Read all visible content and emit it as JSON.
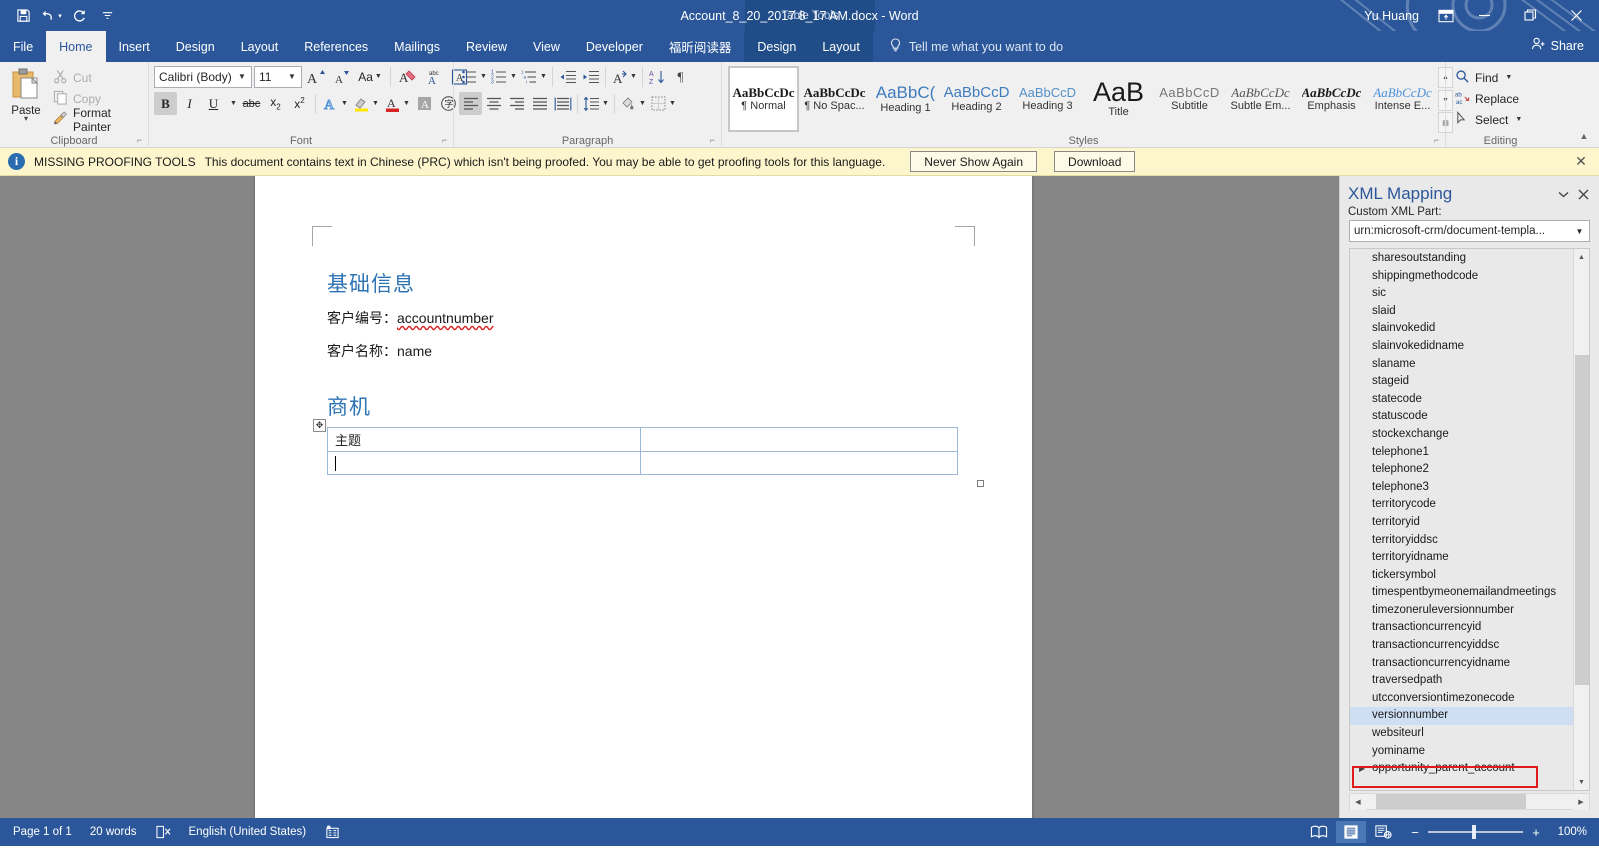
{
  "titlebar": {
    "quick_access": [
      {
        "name": "save-icon",
        "tooltip": "Save"
      },
      {
        "name": "undo-icon",
        "tooltip": "Undo"
      },
      {
        "name": "redo-icon",
        "tooltip": "Redo"
      },
      {
        "name": "customize-qat-icon",
        "tooltip": "Customize Quick Access Toolbar"
      }
    ],
    "document_title": "Account_8_20_2017 8_17 AM.docx  -  Word",
    "contextual_tools_label": "Table Tools",
    "user_name": "Yu Huang",
    "ribbon_display_options": "ribbon-display-icon",
    "minimize": "minimize-icon",
    "restore": "restore-icon",
    "close": "close-icon"
  },
  "tabs": [
    {
      "label": "File",
      "active": false,
      "contextual": false
    },
    {
      "label": "Home",
      "active": true,
      "contextual": false
    },
    {
      "label": "Insert",
      "active": false,
      "contextual": false
    },
    {
      "label": "Design",
      "active": false,
      "contextual": false
    },
    {
      "label": "Layout",
      "active": false,
      "contextual": false
    },
    {
      "label": "References",
      "active": false,
      "contextual": false
    },
    {
      "label": "Mailings",
      "active": false,
      "contextual": false
    },
    {
      "label": "Review",
      "active": false,
      "contextual": false
    },
    {
      "label": "View",
      "active": false,
      "contextual": false
    },
    {
      "label": "Developer",
      "active": false,
      "contextual": false
    },
    {
      "label": "福昕阅读器",
      "active": false,
      "contextual": false
    },
    {
      "label": "Design",
      "active": false,
      "contextual": true
    },
    {
      "label": "Layout",
      "active": false,
      "contextual": true
    }
  ],
  "tell_me": {
    "placeholder": "Tell me what you want to do",
    "icon": "lightbulb-icon"
  },
  "share": {
    "label": "Share",
    "icon": "share-person-icon"
  },
  "ribbon": {
    "groups": [
      {
        "name": "clipboard",
        "label": "Clipboard",
        "paste": {
          "label": "Paste",
          "icon": "paste-icon"
        },
        "items": [
          {
            "label": "Cut",
            "icon": "cut-scissors-icon",
            "disabled": true
          },
          {
            "label": "Copy",
            "icon": "copy-icon",
            "disabled": true
          },
          {
            "label": "Format Painter",
            "icon": "format-painter-icon",
            "disabled": false
          }
        ]
      },
      {
        "name": "font",
        "label": "Font",
        "font_name": "Calibri (Body)",
        "font_size": "11",
        "buttons_row1": [
          {
            "name": "grow-font-icon",
            "label": "A▴"
          },
          {
            "name": "shrink-font-icon",
            "label": "A▾"
          },
          {
            "name": "change-case-icon",
            "label": "Aa"
          },
          {
            "name": "clear-formatting-icon",
            "label": "A"
          },
          {
            "name": "phonetic-guide-icon",
            "label": "⎇"
          },
          {
            "name": "character-border-icon",
            "label": "A"
          }
        ],
        "buttons_row2": [
          {
            "name": "bold-icon",
            "label": "B",
            "active": true
          },
          {
            "name": "italic-icon",
            "label": "I",
            "active": false
          },
          {
            "name": "underline-icon",
            "label": "U",
            "active": false
          },
          {
            "name": "strikethrough-icon",
            "label": "abc",
            "active": false
          },
          {
            "name": "subscript-icon",
            "label": "x₂",
            "active": false
          },
          {
            "name": "superscript-icon",
            "label": "x²",
            "active": false
          },
          {
            "name": "text-effects-icon",
            "label": "A",
            "active": false
          },
          {
            "name": "text-highlight-color-icon",
            "label": "ab",
            "active": false
          },
          {
            "name": "font-color-icon",
            "label": "A",
            "active": false
          },
          {
            "name": "character-shading-icon",
            "label": "A",
            "active": false
          },
          {
            "name": "enclose-characters-icon",
            "label": "字",
            "active": false
          }
        ]
      },
      {
        "name": "paragraph",
        "label": "Paragraph",
        "buttons_row1": [
          {
            "name": "bullets-icon"
          },
          {
            "name": "numbering-icon"
          },
          {
            "name": "multilevel-list-icon"
          },
          {
            "name": "decrease-indent-icon"
          },
          {
            "name": "increase-indent-icon"
          },
          {
            "name": "asian-layout-icon"
          },
          {
            "name": "sort-icon"
          },
          {
            "name": "show-formatting-marks-icon"
          }
        ],
        "buttons_row2": [
          {
            "name": "align-left-icon",
            "active": true
          },
          {
            "name": "align-center-icon",
            "active": false
          },
          {
            "name": "align-right-icon",
            "active": false
          },
          {
            "name": "justify-icon",
            "active": false
          },
          {
            "name": "distributed-icon",
            "active": false
          },
          {
            "name": "line-spacing-icon",
            "active": false
          },
          {
            "name": "shading-icon",
            "active": false
          },
          {
            "name": "borders-icon",
            "active": false
          }
        ]
      },
      {
        "name": "styles",
        "label": "Styles",
        "gallery": [
          {
            "preview": "AaBbCcDc",
            "name": "¶ Normal",
            "selected": true,
            "css": "normal"
          },
          {
            "preview": "AaBbCcDc",
            "name": "¶ No Spac...",
            "selected": false,
            "css": "nospace"
          },
          {
            "preview": "AaBbC(",
            "name": "Heading 1",
            "selected": false,
            "css": "h1"
          },
          {
            "preview": "AaBbCcD",
            "name": "Heading 2",
            "selected": false,
            "css": "h2"
          },
          {
            "preview": "AaBbCcD",
            "name": "Heading 3",
            "selected": false,
            "css": "h3"
          },
          {
            "preview": "AaB",
            "name": "Title",
            "selected": false,
            "css": "title"
          },
          {
            "preview": "AaBbCcD",
            "name": "Subtitle",
            "selected": false,
            "css": "subtitle"
          },
          {
            "preview": "AaBbCcDc",
            "name": "Subtle Em...",
            "selected": false,
            "css": "subtleem"
          },
          {
            "preview": "AaBbCcDc",
            "name": "Emphasis",
            "selected": false,
            "css": "emphasis"
          },
          {
            "preview": "AaBbCcDc",
            "name": "Intense E...",
            "selected": false,
            "css": "intense"
          }
        ]
      },
      {
        "name": "editing",
        "label": "Editing",
        "items": [
          {
            "label": "Find",
            "icon": "find-magnifier-icon",
            "dropdown": true
          },
          {
            "label": "Replace",
            "icon": "replace-icon",
            "dropdown": false
          },
          {
            "label": "Select",
            "icon": "select-pointer-icon",
            "dropdown": true
          }
        ]
      }
    ],
    "collapse_icon": "collapse-ribbon-icon"
  },
  "message_bar": {
    "icon": "info-icon",
    "headline": "MISSING PROOFING TOOLS",
    "text": "This document contains text in Chinese (PRC) which isn't being proofed. You may be able to get proofing tools for this language.",
    "buttons": [
      {
        "label": "Never Show Again"
      },
      {
        "label": "Download"
      }
    ],
    "close": "close-icon"
  },
  "document": {
    "heading1": "基础信息",
    "line1_label": "客户编号：",
    "line1_value": "accountnumber",
    "line2_label": "客户名称：",
    "line2_value": "name",
    "heading2": "商机",
    "table": {
      "move_handle": "table-move-handle",
      "resize_handle": "table-resize-handle",
      "rows": [
        [
          "主题",
          ""
        ],
        [
          "",
          ""
        ]
      ]
    }
  },
  "xml_pane": {
    "title": "XML Mapping",
    "menu_icon": "chevron-down-icon",
    "close_icon": "close-icon",
    "custom_part_label": "Custom XML Part:",
    "custom_part_value": "urn:microsoft-crm/document-templa...",
    "nodes": [
      {
        "label": "sharesoutstanding",
        "selected": false,
        "expandable": false,
        "highlight": false
      },
      {
        "label": "shippingmethodcode",
        "selected": false,
        "expandable": false,
        "highlight": false
      },
      {
        "label": "sic",
        "selected": false,
        "expandable": false,
        "highlight": false
      },
      {
        "label": "slaid",
        "selected": false,
        "expandable": false,
        "highlight": false
      },
      {
        "label": "slainvokedid",
        "selected": false,
        "expandable": false,
        "highlight": false
      },
      {
        "label": "slainvokedidname",
        "selected": false,
        "expandable": false,
        "highlight": false
      },
      {
        "label": "slaname",
        "selected": false,
        "expandable": false,
        "highlight": false
      },
      {
        "label": "stageid",
        "selected": false,
        "expandable": false,
        "highlight": false
      },
      {
        "label": "statecode",
        "selected": false,
        "expandable": false,
        "highlight": false
      },
      {
        "label": "statuscode",
        "selected": false,
        "expandable": false,
        "highlight": false
      },
      {
        "label": "stockexchange",
        "selected": false,
        "expandable": false,
        "highlight": false
      },
      {
        "label": "telephone1",
        "selected": false,
        "expandable": false,
        "highlight": false
      },
      {
        "label": "telephone2",
        "selected": false,
        "expandable": false,
        "highlight": false
      },
      {
        "label": "telephone3",
        "selected": false,
        "expandable": false,
        "highlight": false
      },
      {
        "label": "territorycode",
        "selected": false,
        "expandable": false,
        "highlight": false
      },
      {
        "label": "territoryid",
        "selected": false,
        "expandable": false,
        "highlight": false
      },
      {
        "label": "territoryiddsc",
        "selected": false,
        "expandable": false,
        "highlight": false
      },
      {
        "label": "territoryidname",
        "selected": false,
        "expandable": false,
        "highlight": false
      },
      {
        "label": "tickersymbol",
        "selected": false,
        "expandable": false,
        "highlight": false
      },
      {
        "label": "timespentbymeonemailandmeetings",
        "selected": false,
        "expandable": false,
        "highlight": false
      },
      {
        "label": "timezoneruleversionnumber",
        "selected": false,
        "expandable": false,
        "highlight": false
      },
      {
        "label": "transactioncurrencyid",
        "selected": false,
        "expandable": false,
        "highlight": false
      },
      {
        "label": "transactioncurrencyiddsc",
        "selected": false,
        "expandable": false,
        "highlight": false
      },
      {
        "label": "transactioncurrencyidname",
        "selected": false,
        "expandable": false,
        "highlight": false
      },
      {
        "label": "traversedpath",
        "selected": false,
        "expandable": false,
        "highlight": false
      },
      {
        "label": "utcconversiontimezonecode",
        "selected": false,
        "expandable": false,
        "highlight": false
      },
      {
        "label": "versionnumber",
        "selected": true,
        "expandable": false,
        "highlight": false
      },
      {
        "label": "websiteurl",
        "selected": false,
        "expandable": false,
        "highlight": false
      },
      {
        "label": "yominame",
        "selected": false,
        "expandable": false,
        "highlight": false
      },
      {
        "label": "opportunity_parent_account",
        "selected": false,
        "expandable": true,
        "highlight": true
      }
    ]
  },
  "status_bar": {
    "page": "Page 1 of 1",
    "words": "20 words",
    "proofing_icon": "proofing-errors-icon",
    "language": "English (United States)",
    "macro_icon": "record-macro-icon",
    "views": [
      {
        "name": "read-mode-icon",
        "active": false
      },
      {
        "name": "print-layout-icon",
        "active": true
      },
      {
        "name": "web-layout-icon",
        "active": false
      }
    ],
    "zoom_out": "−",
    "zoom_in": "+",
    "zoom_level": "100%"
  },
  "colors": {
    "accent": "#2b579a",
    "heading": "#2e74b5",
    "message_bar": "#fdf6cd",
    "highlight_red": "#e01b1b",
    "selection_blue": "#cfdff3"
  }
}
